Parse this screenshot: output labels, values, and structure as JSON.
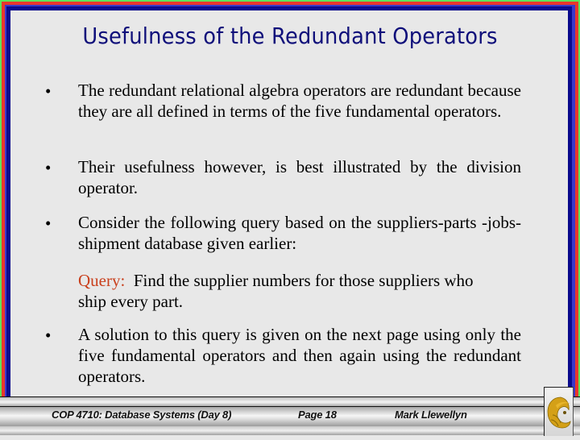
{
  "slide": {
    "title": "Usefulness of the Redundant Operators",
    "bullets": [
      {
        "marker": "•",
        "text": "The redundant relational algebra operators are redundant because they are all defined in terms of the five fundamental operators."
      },
      {
        "marker": "•",
        "text": "Their usefulness however, is best illustrated by the division operator."
      },
      {
        "marker": "•",
        "text": "Consider the following query based on the suppliers-parts -jobs-shipment database given earlier:"
      },
      {
        "marker": "•",
        "text": "A solution to this query is given on the next page using only the five fundamental operators and then again using the redundant operators."
      }
    ],
    "query": {
      "label": "Query:",
      "text": "  Find the supplier numbers for those suppliers who ship every part."
    }
  },
  "footer": {
    "course": "COP 4710: Database Systems  (Day 8)",
    "page": "Page 18",
    "author": "Mark Llewellyn",
    "logo_icon": "pegasus-logo-icon"
  },
  "colors": {
    "title": "#0f0f7a",
    "query_label": "#c9401d",
    "border_green": "#5ee35a",
    "border_red": "#e8372c",
    "border_purple": "#3a38c8",
    "border_navy": "#0a0a8c",
    "background": "#e8e8e8",
    "logo_gold": "#d4a017"
  }
}
